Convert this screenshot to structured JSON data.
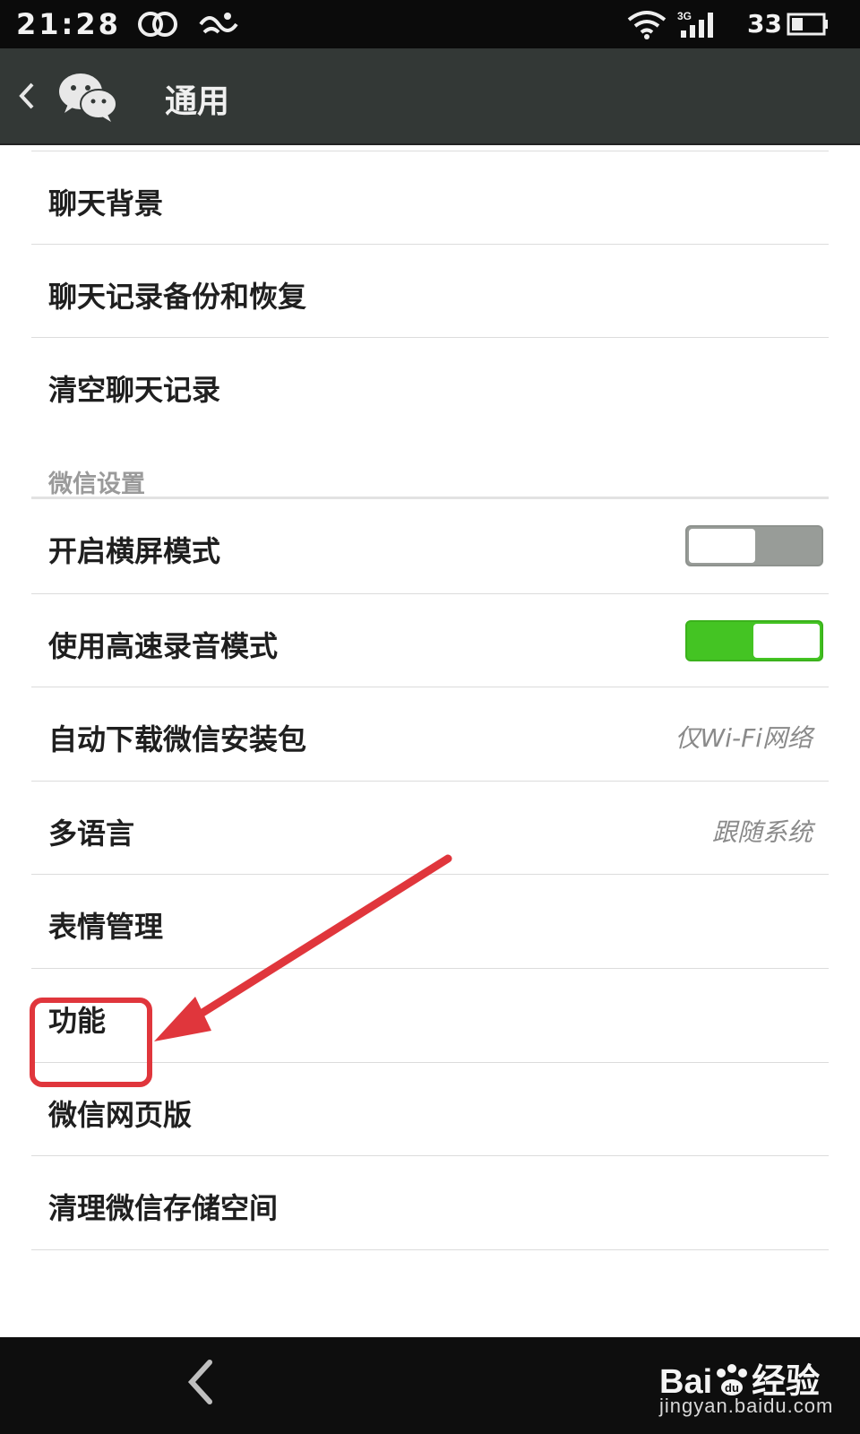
{
  "status_bar": {
    "time": "21:28",
    "network": "3G",
    "battery": "33"
  },
  "header": {
    "title": "通用"
  },
  "list": {
    "items_top": [
      {
        "label": "聊天背景"
      },
      {
        "label": "聊天记录备份和恢复"
      },
      {
        "label": "清空聊天记录"
      }
    ],
    "section_title": "微信设置",
    "toggles": [
      {
        "label": "开启横屏模式",
        "state": "off"
      },
      {
        "label": "使用高速录音模式",
        "state": "on"
      }
    ],
    "items_value": [
      {
        "label": "自动下载微信安装包",
        "value": "仅Wi-Fi网络"
      },
      {
        "label": "多语言",
        "value": "跟随系统"
      }
    ],
    "items_bottom": [
      {
        "label": "表情管理"
      },
      {
        "label": "功能"
      },
      {
        "label": "微信网页版"
      },
      {
        "label": "清理微信存储空间"
      }
    ]
  },
  "annotation": {
    "highlight_color": "#e0363c",
    "target": "功能"
  },
  "watermark": {
    "logo": "Bai",
    "logo_suffix": "经验",
    "url": "jingyan.baidu.com"
  },
  "colors": {
    "toggle_on": "#44c423",
    "toggle_off": "#989c98",
    "actionbar": "#333836"
  }
}
